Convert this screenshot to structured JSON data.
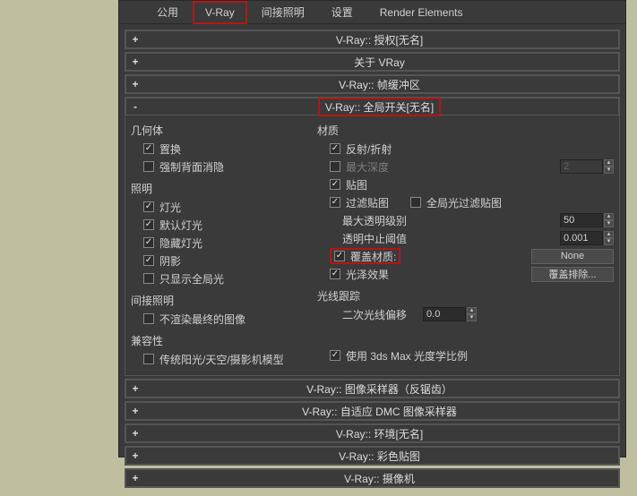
{
  "tabs": [
    "公用",
    "V-Ray",
    "间接照明",
    "设置",
    "Render Elements"
  ],
  "rollups": {
    "auth": {
      "title": "V-Ray:: 授权[无名]"
    },
    "about": {
      "title": "关于 VRay"
    },
    "fb": {
      "title": "V-Ray:: 帧缓冲区"
    },
    "global": {
      "title": "V-Ray:: 全局开关[无名]"
    },
    "sampler": {
      "title": "V-Ray:: 图像采样器（反锯齿）"
    },
    "dmc": {
      "title": "V-Ray:: 自适应 DMC 图像采样器"
    },
    "env": {
      "title": "V-Ray:: 环境[无名]"
    },
    "color": {
      "title": "V-Ray:: 彩色贴图"
    },
    "cam": {
      "title": "V-Ray:: 摄像机"
    }
  },
  "left": {
    "geometry_label": "几何体",
    "displacement": "置换",
    "force_backface": "强制背面消隐",
    "lighting_label": "照明",
    "lights": "灯光",
    "default_lights": "默认灯光",
    "hidden_lights": "隐藏灯光",
    "shadows": "阴影",
    "show_gi_only": "只显示全局光",
    "indirect_label": "间接照明",
    "no_render_final": "不渲染最终的图像",
    "compat_label": "兼容性",
    "legacy_sun": "传统阳光/天空/摄影机模型"
  },
  "right": {
    "materials_label": "材质",
    "refl_refr": "反射/折射",
    "max_depth": "最大深度",
    "max_depth_val": "2",
    "maps": "贴图",
    "filter_maps": "过滤贴图",
    "gi_filter_maps": "全局光过滤贴图",
    "max_transp": "最大透明级别",
    "max_transp_val": "50",
    "transp_cutoff": "透明中止阈值",
    "transp_cutoff_val": "0.001",
    "override_mtl": "覆盖材质:",
    "override_none": "None",
    "glossy": "光泽效果",
    "override_excl": "覆盖排除...",
    "ray_label": "光线跟踪",
    "sec_bias": "二次光线偏移",
    "sec_bias_val": "0.0",
    "use_3dsmax": "使用 3ds Max 光度学比例"
  }
}
